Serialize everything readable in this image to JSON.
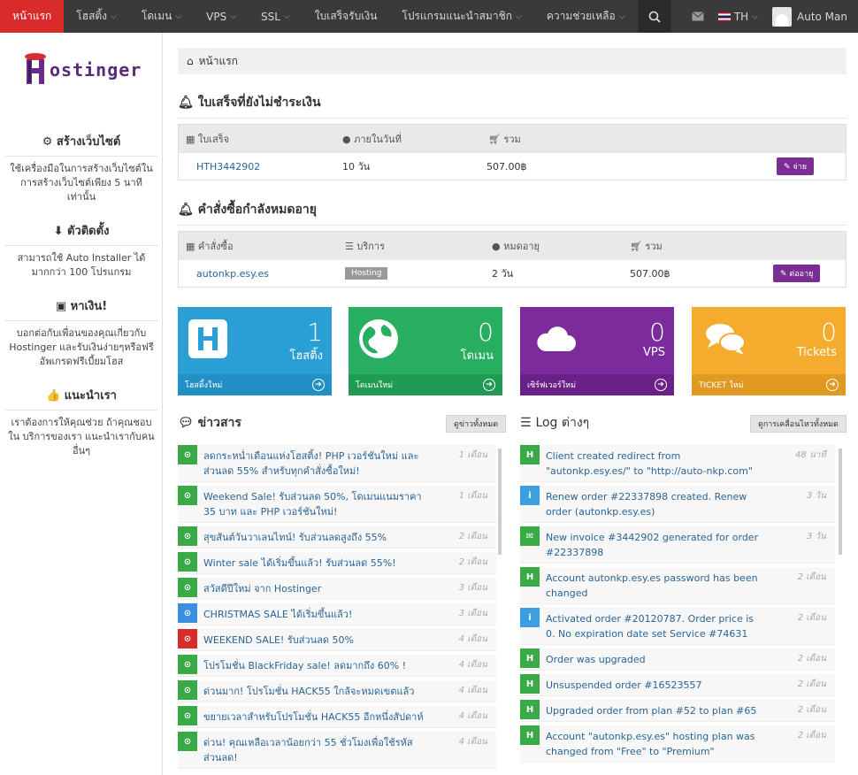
{
  "nav": {
    "items": [
      {
        "label": "หน้าแรก",
        "caret": false,
        "active": true
      },
      {
        "label": "โฮสติ้ง",
        "caret": true
      },
      {
        "label": "โดเมน",
        "caret": true
      },
      {
        "label": "VPS",
        "caret": true
      },
      {
        "label": "SSL",
        "caret": true
      },
      {
        "label": "ใบเสร็จรับเงิน",
        "caret": false
      },
      {
        "label": "โปรแกรมแนะนำสมาชิก",
        "caret": true
      },
      {
        "label": "ความช่วยเหลือ",
        "caret": true
      }
    ],
    "language": "TH",
    "user": "Auto Man"
  },
  "sidebar": {
    "logo_text": "ostinger",
    "sections": [
      {
        "title": "สร้างเว็บไซต์",
        "text": "ใช้เครื่องมือในการสร้างเว็บไซต์ใน การสร้างเว็บไซต์เพียง 5 นาที เท่านั้น"
      },
      {
        "title": "ตัวติดตั้ง",
        "text": "สามารถใช้ Auto Installer ได้ มากกว่า 100 โปรแกรม"
      },
      {
        "title": "หาเงิน!",
        "text": "บอกต่อกับเพื่อนของคุณเกี่ยวกับ Hostinger และรับเงินง่ายๆหรือฟรี อัพเกรดฟรีเบี้ยมโฮส"
      },
      {
        "title": "แนะนำเรา",
        "text": "เราต้องการให้คุณช่วย ถ้าคุณชอบใน บริการของเรา แนะนำเรากับคนอื่นๆ"
      }
    ]
  },
  "breadcrumb": "หน้าแรก",
  "unpaid": {
    "title": "ใบเสร็จที่ยังไม่ชำระเงิน",
    "headers": [
      "ใบเสร็จ",
      "ภายในวันที่",
      "รวม"
    ],
    "rows": [
      {
        "id": "HTH3442902",
        "due": "10 วัน",
        "total": "507.00฿",
        "action": "จ่าย"
      }
    ]
  },
  "expiring": {
    "title": "คำสั่งซื้อกำลังหมดอายุ",
    "headers": [
      "คำสั่งซื้อ",
      "บริการ",
      "หมดอายุ",
      "รวม"
    ],
    "rows": [
      {
        "domain": "autonkp.esy.es",
        "service": "Hosting",
        "expires": "2 วัน",
        "total": "507.00฿",
        "action": "ต่ออายุ"
      }
    ]
  },
  "tiles": [
    {
      "count": "1",
      "label": "โฮสติ้ง",
      "footer": "โฮสติ้งใหม่",
      "color": "#2a9fd6",
      "icon": "hosting-icon"
    },
    {
      "count": "0",
      "label": "โดเมน",
      "footer": "โดเมนใหม่",
      "color": "#27ae60",
      "icon": "globe-icon"
    },
    {
      "count": "0",
      "label": "VPS",
      "footer": "เซิร์ฟเวอร์ใหม่",
      "color": "#7b2b9b",
      "icon": "cloud-icon"
    },
    {
      "count": "0",
      "label": "Tickets",
      "footer": "TICKET ใหม่",
      "color": "#f5ac2e",
      "icon": "chat-icon"
    }
  ],
  "news": {
    "title": "ข่าวสาร",
    "button": "ดูข่าวทั้งหมด",
    "items": [
      {
        "text": "ลดกระหน่ำเดือนแห่งโฮสติ้ง! PHP เวอร์ชันใหม่ และ ส่วนลด 55% สำหรับทุกคำสั่งซื้อใหม่!",
        "time": "1 เดือน",
        "color": "#3aaa47",
        "lines": 2
      },
      {
        "text": "Weekend Sale! รับส่วนลด 50%, โดเมนแนมราคา 35 บาท และ PHP เวอร์ชันใหม่!",
        "time": "1 เดือน",
        "color": "#3aaa47",
        "lines": 2
      },
      {
        "text": "สุขสันต์วันวาเลนไทน์! รับส่วนลดสูงถึง 55%",
        "time": "2 เดือน",
        "color": "#3aaa47",
        "lines": 1
      },
      {
        "text": "Winter sale ได้เริ่มขึ้นแล้ว! รับส่วนลด 55%!",
        "time": "2 เดือน",
        "color": "#3aaa47",
        "lines": 1
      },
      {
        "text": "สวัสดีปีใหม่ จาก Hostinger",
        "time": "3 เดือน",
        "color": "#3aaa47",
        "lines": 1
      },
      {
        "text": "CHRISTMAS SALE ได้เริ่มขึ้นแล้ว!",
        "time": "3 เดือน",
        "color": "#3b8fe0",
        "lines": 1
      },
      {
        "text": "WEEKEND SALE! รับส่วนลด 50%",
        "time": "4 เดือน",
        "color": "#d92b2b",
        "lines": 1
      },
      {
        "text": "โปรโมชั่น BlackFriday sale! ลดมากถึง 60% !",
        "time": "4 เดือน",
        "color": "#3aaa47",
        "lines": 1
      },
      {
        "text": "ด่วนมาก! โปรโมชั่น HACK55 ใกล้จะหมดเขตแล้ว",
        "time": "4 เดือน",
        "color": "#3aaa47",
        "lines": 1
      },
      {
        "text": "ขยายเวลาสำหรับโปรโมชั่น HACK55 อีกหนึ่งสัปดาห์",
        "time": "4 เดือน",
        "color": "#3aaa47",
        "lines": 1
      },
      {
        "text": "ด่วน! คุณเหลือเวลาน้อยกว่า 55 ชั่วโมงเพื่อใช้รหัส ส่วนลด!",
        "time": "4 เดือน",
        "color": "#3aaa47",
        "lines": 2
      }
    ]
  },
  "log": {
    "title": "Log ต่างๆ",
    "button": "ดูการเคลื่อนไหวทั้งหมด",
    "items": [
      {
        "text": "Client created redirect from \"autonkp.esy.es/\" to \"http://auto-nkp.com\"",
        "time": "48 นาที",
        "color": "#3aaa47",
        "glyph": "H",
        "lines": 2
      },
      {
        "text": "Renew order #22337898 created. Renew order (autonkp.esy.es)",
        "time": "3 วัน",
        "color": "#3b9fe0",
        "glyph": "i",
        "lines": 2
      },
      {
        "text": "New invoice #3442902 generated for order #22337898",
        "time": "3 วัน",
        "color": "#3aaa47",
        "glyph": "✉",
        "lines": 2
      },
      {
        "text": "Account autonkp.esy.es password has been changed",
        "time": "2 เดือน",
        "color": "#3aaa47",
        "glyph": "H",
        "lines": 2
      },
      {
        "text": "Activated order #20120787. Order price is 0. No expiration date set Service #74631",
        "time": "2 เดือน",
        "color": "#3b9fe0",
        "glyph": "i",
        "lines": 2
      },
      {
        "text": "Order was upgraded",
        "time": "2 เดือน",
        "color": "#3aaa47",
        "glyph": "H",
        "lines": 1
      },
      {
        "text": "Unsuspended order #16523557",
        "time": "2 เดือน",
        "color": "#3aaa47",
        "glyph": "H",
        "lines": 1
      },
      {
        "text": "Upgraded order from plan #52 to plan #65",
        "time": "2 เดือน",
        "color": "#3aaa47",
        "glyph": "H",
        "lines": 1
      },
      {
        "text": "Account \"autonkp.esy.es\" hosting plan was changed from \"Free\" to \"Premium\"",
        "time": "2 เดือน",
        "color": "#3aaa47",
        "glyph": "H",
        "lines": 2
      }
    ]
  }
}
